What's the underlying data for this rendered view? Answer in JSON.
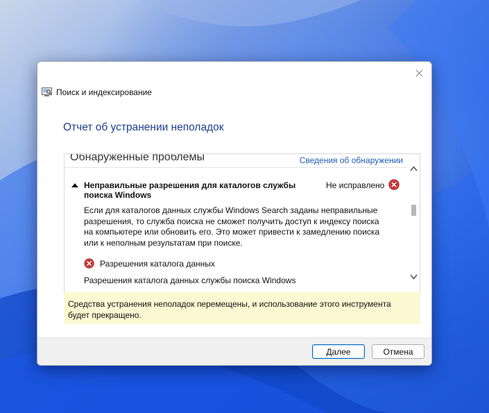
{
  "window": {
    "title": "Поиск и индексирование"
  },
  "dialog": {
    "heading": "Отчет об устранении неполадок",
    "section_title": "Обнаруженные проблемы",
    "details_link": "Сведения об обнаружении",
    "problem": {
      "title": "Неправильные разрешения для каталогов службы поиска Windows",
      "status": "Не исправлено",
      "description": "Если для каталогов данных службы Windows Search заданы неправильные разрешения, то служба поиска не сможет получить доступ к индексу поиска на компьютере или обновить его. Это может привести к замедлению поиска или к неполным результатам при поиске.",
      "cause_label": "Разрешения каталога данных",
      "cause_detail": "Разрешения каталога данных службы поиска Windows"
    },
    "notice": "Средства устранения неполадок перемещены, и использование этого инструмента будет прекращено.",
    "buttons": {
      "next": "Далее",
      "cancel": "Отмена"
    }
  },
  "colors": {
    "heading": "#1d3f8f",
    "link": "#1f5bb6",
    "notice_bg": "#fcf8d2",
    "error_red": "#c62828"
  },
  "icons": {
    "app": "search-indexing-icon",
    "status": "error-icon",
    "close": "close-icon"
  }
}
